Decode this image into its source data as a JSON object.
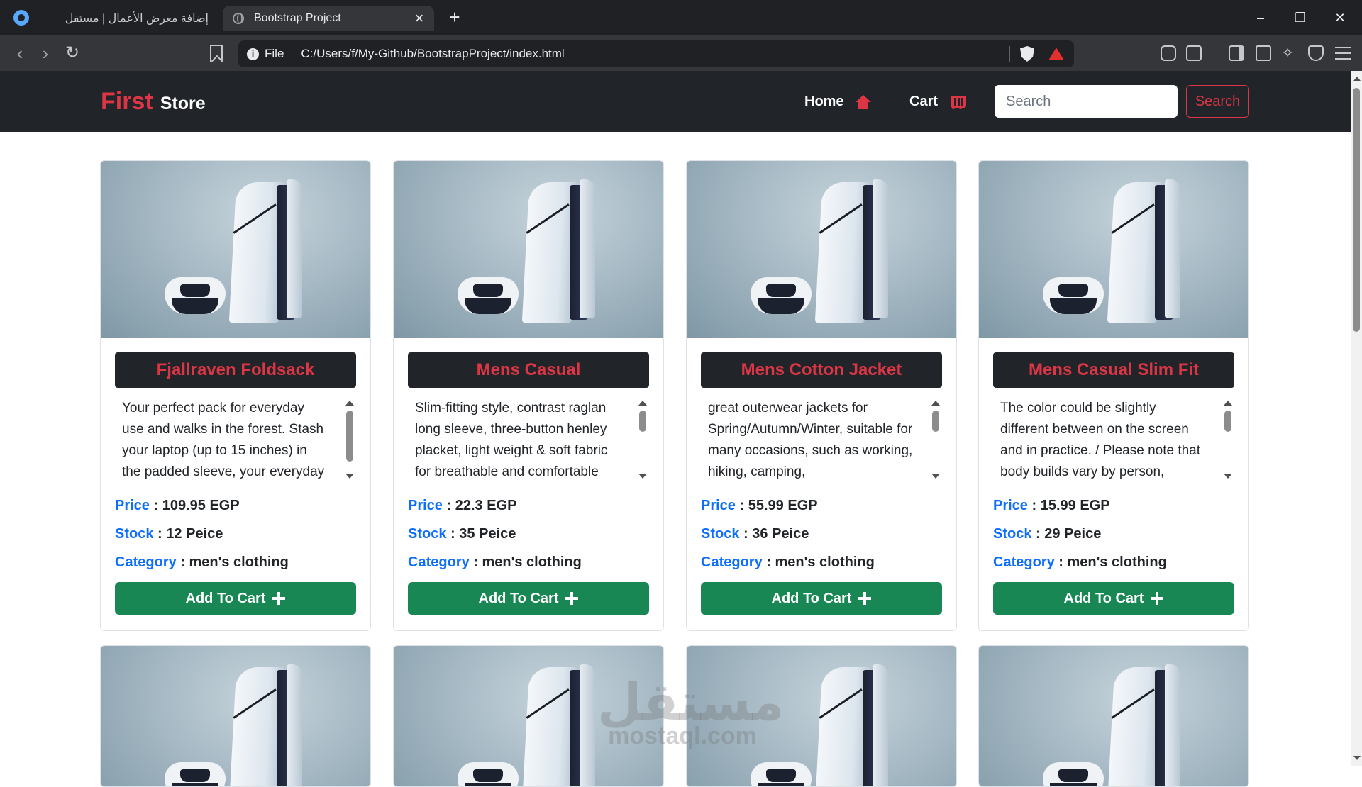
{
  "browser": {
    "tabs": [
      {
        "title": "إضافة معرض الأعمال | مستقل",
        "active": false
      },
      {
        "title": "Bootstrap Project",
        "active": true
      }
    ],
    "new_tab_symbol": "+",
    "close_symbol": "×",
    "window_controls": [
      "–",
      "❐",
      "✕"
    ],
    "address": {
      "scheme_label": "File",
      "url": "C:/Users/f/My-Github/BootstrapProject/index.html"
    },
    "icons": [
      "back-icon",
      "forward-icon",
      "reload-icon",
      "bookmark-icon",
      "info-icon",
      "brave-shield-icon",
      "brave-rewards-icon",
      "extensions-icon",
      "screenshot-icon",
      "sidebar-icon",
      "wallet-icon",
      "leo-ai-icon",
      "vpn-icon",
      "menu-icon"
    ]
  },
  "navbar": {
    "brand_first": "First",
    "brand_store": "Store",
    "links": [
      {
        "label": "Home",
        "icon": "home-icon"
      },
      {
        "label": "Cart",
        "icon": "cart-icon"
      }
    ],
    "search_placeholder": "Search",
    "search_button": "Search"
  },
  "labels": {
    "price": "Price",
    "stock": "Stock",
    "category": "Category",
    "separator": ":",
    "currency": "EGP",
    "stock_unit": "Peice",
    "add_to_cart": "Add To Cart"
  },
  "products": [
    {
      "title": "Fjallraven Foldsack",
      "description": "Your perfect pack for everyday use and walks in the forest. Stash your laptop (up to 15 inches) in the padded sleeve, your everyday",
      "price": "109.95",
      "stock": "12",
      "category": "men's clothing"
    },
    {
      "title": "Mens Casual",
      "description": "Slim-fitting style, contrast raglan long sleeve, three-button henley placket, light weight & soft fabric for breathable and comfortable",
      "price": "22.3",
      "stock": "35",
      "category": "men's clothing"
    },
    {
      "title": "Mens Cotton Jacket",
      "description": "great outerwear jackets for Spring/Autumn/Winter, suitable for many occasions, such as working, hiking, camping,",
      "price": "55.99",
      "stock": "36",
      "category": "men's clothing"
    },
    {
      "title": "Mens Casual Slim Fit",
      "description": "The color could be slightly different between on the screen and in practice. / Please note that body builds vary by person,",
      "price": "15.99",
      "stock": "29",
      "category": "men's clothing"
    }
  ],
  "colors": {
    "navbar_bg": "#212529",
    "accent_red": "#dc3545",
    "key_blue": "#0d6efd",
    "button_green": "#198754"
  },
  "watermark": {
    "arabic": "مستقل",
    "latin": "mostaql.com"
  }
}
